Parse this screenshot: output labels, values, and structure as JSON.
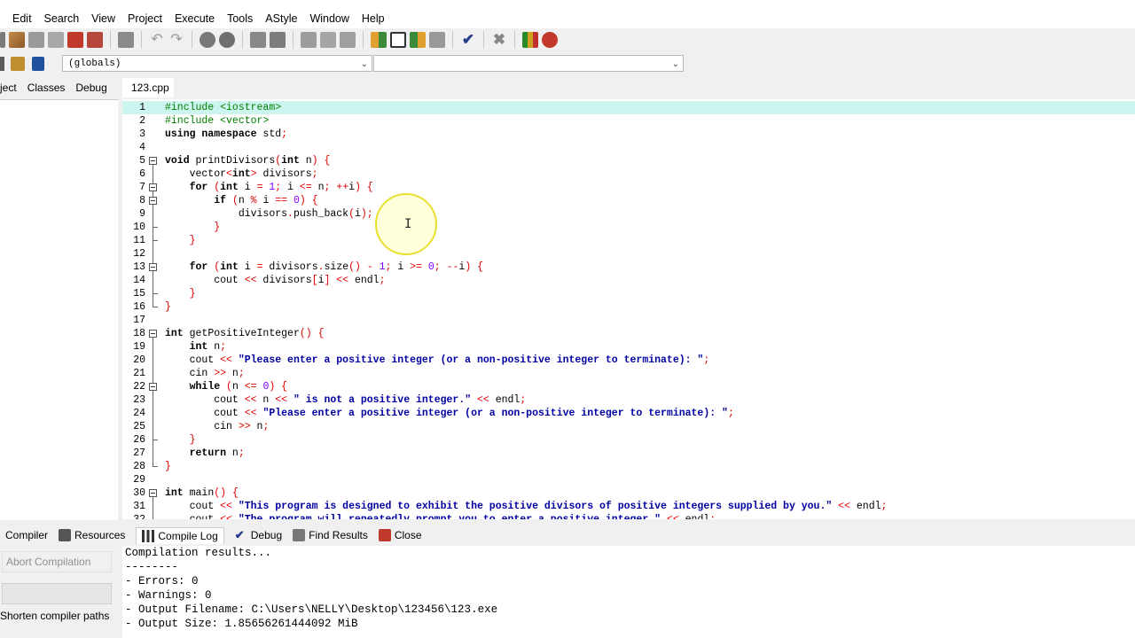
{
  "menu": [
    "Edit",
    "Search",
    "View",
    "Project",
    "Execute",
    "Tools",
    "AStyle",
    "Window",
    "Help"
  ],
  "toolbar": {
    "scope_combo": "(globals)",
    "member_combo": ""
  },
  "left_panel": {
    "tabs": [
      "ject",
      "Classes",
      "Debug"
    ]
  },
  "editor": {
    "tab": "123.cpp",
    "lines": [
      {
        "n": "1",
        "html": "<span class='pp'>#include &lt;iostream&gt;</span>"
      },
      {
        "n": "2",
        "html": "<span class='pp'>#include &lt;vector&gt;</span>"
      },
      {
        "n": "3",
        "html": "<span class='kw'>using namespace</span> std<span class='op'>;</span>"
      },
      {
        "n": "4",
        "html": ""
      },
      {
        "n": "5",
        "html": "<span class='kw'>void</span> printDivisors<span class='op'>(</span><span class='kw'>int</span> n<span class='op'>) {</span>"
      },
      {
        "n": "6",
        "html": "    vector<span class='op'>&lt;</span><span class='kw'>int</span><span class='op'>&gt;</span> divisors<span class='op'>;</span>"
      },
      {
        "n": "7",
        "html": "    <span class='kw'>for</span> <span class='op'>(</span><span class='kw'>int</span> i <span class='op'>=</span> <span class='num'>1</span><span class='op'>;</span> i <span class='op'>&lt;=</span> n<span class='op'>; ++</span>i<span class='op'>) {</span>"
      },
      {
        "n": "8",
        "html": "        <span class='kw'>if</span> <span class='op'>(</span>n <span class='op'>%</span> i <span class='op'>==</span> <span class='num'>0</span><span class='op'>) {</span>"
      },
      {
        "n": "9",
        "html": "            divisors<span class='op'>.</span>push_back<span class='op'>(</span>i<span class='op'>);</span>"
      },
      {
        "n": "10",
        "html": "        <span class='op'>}</span>"
      },
      {
        "n": "11",
        "html": "    <span class='op'>}</span>"
      },
      {
        "n": "12",
        "html": ""
      },
      {
        "n": "13",
        "html": "    <span class='kw'>for</span> <span class='op'>(</span><span class='kw'>int</span> i <span class='op'>=</span> divisors<span class='op'>.</span>size<span class='op'>() -</span> <span class='num'>1</span><span class='op'>;</span> i <span class='op'>&gt;=</span> <span class='num'>0</span><span class='op'>; --</span>i<span class='op'>) {</span>"
      },
      {
        "n": "14",
        "html": "        cout <span class='op'>&lt;&lt;</span> divisors<span class='op'>[</span>i<span class='op'>] &lt;&lt;</span> endl<span class='op'>;</span>"
      },
      {
        "n": "15",
        "html": "    <span class='op'>}</span>"
      },
      {
        "n": "16",
        "html": "<span class='op'>}</span>"
      },
      {
        "n": "17",
        "html": ""
      },
      {
        "n": "18",
        "html": "<span class='kw'>int</span> getPositiveInteger<span class='op'>() {</span>"
      },
      {
        "n": "19",
        "html": "    <span class='kw'>int</span> n<span class='op'>;</span>"
      },
      {
        "n": "20",
        "html": "    cout <span class='op'>&lt;&lt;</span> <span class='str'>\"Please enter a positive integer (or a non-positive integer to terminate): \"</span><span class='op'>;</span>"
      },
      {
        "n": "21",
        "html": "    cin <span class='op'>&gt;&gt;</span> n<span class='op'>;</span>"
      },
      {
        "n": "22",
        "html": "    <span class='kw'>while</span> <span class='op'>(</span>n <span class='op'>&lt;=</span> <span class='num'>0</span><span class='op'>) {</span>"
      },
      {
        "n": "23",
        "html": "        cout <span class='op'>&lt;&lt;</span> n <span class='op'>&lt;&lt;</span> <span class='str'>\" is not a positive integer.\"</span> <span class='op'>&lt;&lt;</span> endl<span class='op'>;</span>"
      },
      {
        "n": "24",
        "html": "        cout <span class='op'>&lt;&lt;</span> <span class='str'>\"Please enter a positive integer (or a non-positive integer to terminate): \"</span><span class='op'>;</span>"
      },
      {
        "n": "25",
        "html": "        cin <span class='op'>&gt;&gt;</span> n<span class='op'>;</span>"
      },
      {
        "n": "26",
        "html": "    <span class='op'>}</span>"
      },
      {
        "n": "27",
        "html": "    <span class='kw'>return</span> n<span class='op'>;</span>"
      },
      {
        "n": "28",
        "html": "<span class='op'>}</span>"
      },
      {
        "n": "29",
        "html": ""
      },
      {
        "n": "30",
        "html": "<span class='kw'>int</span> main<span class='op'>() {</span>"
      },
      {
        "n": "31",
        "html": "    cout <span class='op'>&lt;&lt;</span> <span class='str'>\"This program is designed to exhibit the positive divisors of positive integers supplied by you.\"</span> <span class='op'>&lt;&lt;</span> endl<span class='op'>;</span>"
      },
      {
        "n": "32",
        "html": "    cout <span class='op'>&lt;&lt;</span> <span class='str'>\"The program will repeatedly prompt you to enter a positive integer.\"</span> <span class='op'>&lt;&lt;</span> endl<span class='op'>;</span>"
      }
    ]
  },
  "bottom_tabs": [
    "Compiler",
    "Resources",
    "Compile Log",
    "Debug",
    "Find Results",
    "Close"
  ],
  "bottom_panel": {
    "abort_label": "Abort Compilation",
    "shorten_label": "Shorten compiler paths",
    "log_lines": [
      "Compilation results...",
      "--------",
      "- Errors: 0",
      "- Warnings: 0",
      "- Output Filename: C:\\Users\\NELLY\\Desktop\\123456\\123.exe",
      "- Output Size: 1.85656261444092 MiB"
    ]
  },
  "colors": {
    "current_line": "#ccf5f0",
    "keyword": "#000000",
    "operator": "#e00000",
    "string": "#0000a0",
    "preprocessor": "#008000",
    "number": "#8000ff"
  }
}
